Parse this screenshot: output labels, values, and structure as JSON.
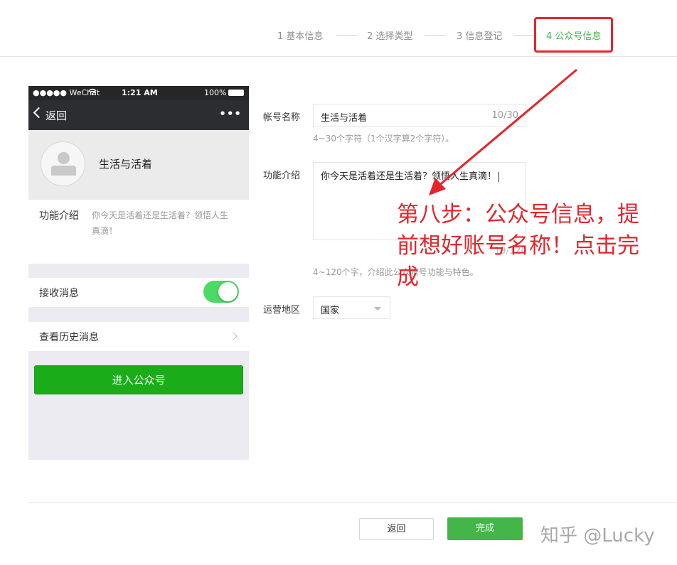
{
  "steps": [
    {
      "label": "1 基本信息",
      "active": false
    },
    {
      "label": "2 选择类型",
      "active": false
    },
    {
      "label": "3 信息登记",
      "active": false
    },
    {
      "label": "4 公众号信息",
      "active": true
    }
  ],
  "phone": {
    "status": {
      "carrier": "●●●●● WeChat",
      "wifi_icon": "wifi-icon",
      "time": "1:21 AM",
      "battery": "100%"
    },
    "nav": {
      "back_label": "返回",
      "more": "•••"
    },
    "profile": {
      "name": "生活与活着"
    },
    "intro": {
      "label": "功能介绍",
      "text": "你今天是活着还是生活着？领悟人生真滴！"
    },
    "receive": {
      "label": "接收消息",
      "enabled": true
    },
    "history": {
      "label": "查看历史消息"
    },
    "enter_button": "进入公众号"
  },
  "form": {
    "account_name": {
      "label": "帐号名称",
      "value": "生活与活着",
      "count": "10/30",
      "hint": "4~30个字符（1个汉字算2个字符）。"
    },
    "intro": {
      "label": "功能介绍",
      "value": "你今天是活着还是生活着？领悟人生真滴！",
      "count": "19/120",
      "hint": "4~120个字，介绍此公众帐号功能与特色。"
    },
    "region": {
      "label": "运营地区",
      "value": "国家"
    }
  },
  "annotation": {
    "text": "第八步：公众号信息，提前想好账号名称！点击完成",
    "color": "#e3262c"
  },
  "footer": {
    "back_label": "返回",
    "done_label": "完成"
  },
  "watermark": "知乎 @Lucky",
  "colors": {
    "accent": "#44b549",
    "wechat_green": "#1aad19",
    "annotation_red": "#e3262c"
  }
}
